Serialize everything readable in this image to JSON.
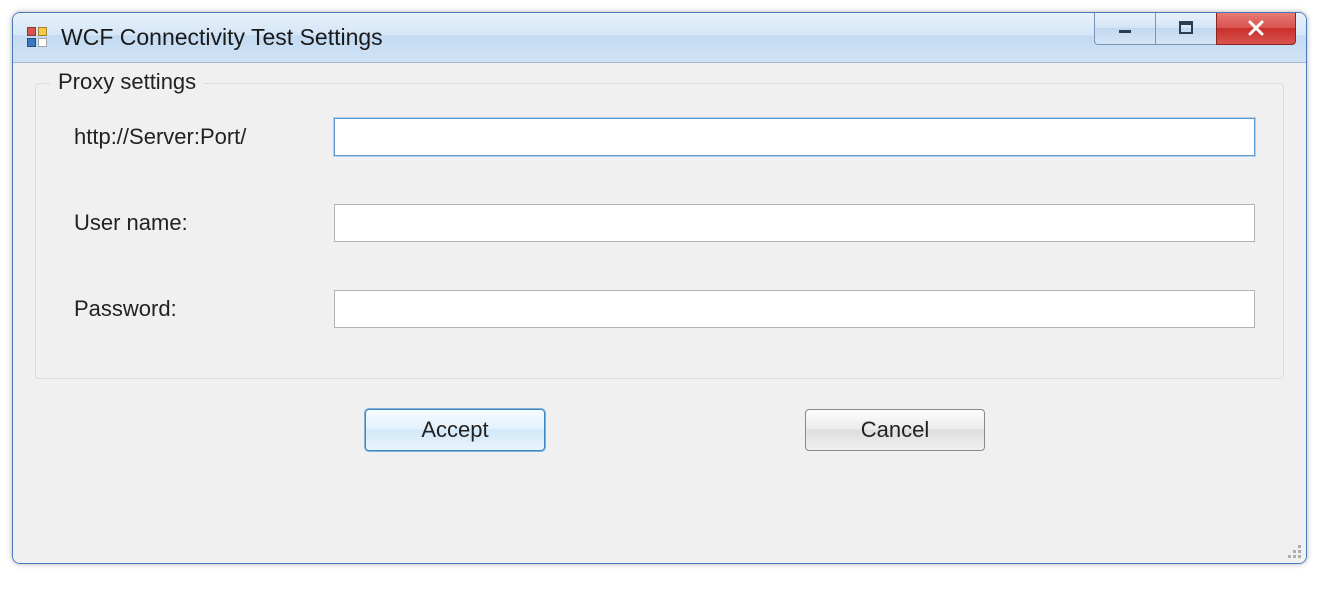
{
  "window": {
    "title": "WCF Connectivity Test Settings"
  },
  "groupbox": {
    "legend": "Proxy settings",
    "fields": {
      "server": {
        "label": "http://Server:Port/",
        "value": ""
      },
      "username": {
        "label": "User name:",
        "value": ""
      },
      "password": {
        "label": "Password:",
        "value": ""
      }
    }
  },
  "buttons": {
    "accept": "Accept",
    "cancel": "Cancel"
  }
}
